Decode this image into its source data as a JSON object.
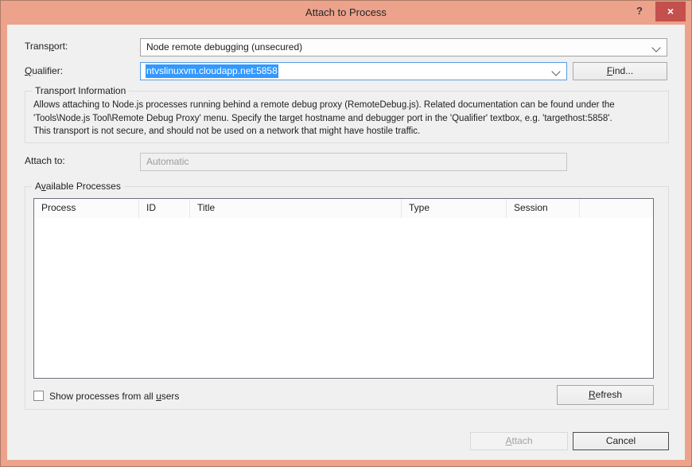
{
  "colors": {
    "chrome": "#eca28b",
    "chrome_edge": "#ab7a66",
    "close_red": "#c4504e",
    "selection": "#3399ff",
    "focus_border": "#569de5",
    "content_bg": "#f0f0f0"
  },
  "titlebar": {
    "title": "Attach to Process",
    "help_glyph": "?",
    "close_glyph": "×"
  },
  "transport": {
    "label_pre": "Trans",
    "label_key": "p",
    "label_post": "ort:",
    "value": "Node remote debugging (unsecured)"
  },
  "qualifier": {
    "label_pre": "",
    "label_key": "Q",
    "label_post": "ualifier:",
    "value": "ntvslinuxvm.cloudapp.net:5858",
    "find_pre": "",
    "find_key": "F",
    "find_post": "ind..."
  },
  "transport_info": {
    "title": "Transport Information",
    "line1": "Allows attaching to Node.js processes running behind a remote debug proxy (RemoteDebug.js). Related documentation can be found under the",
    "line2": "'Tools\\Node.js Tool\\Remote Debug Proxy' menu. Specify the target hostname and debugger port in the 'Qualifier' textbox, e.g. 'targethost:5858'.",
    "line3": "This transport is not secure, and should not be used on a network that might have hostile traffic."
  },
  "attach_to": {
    "label": "Attach to:",
    "value": "Automatic"
  },
  "processes": {
    "group_pre": "A",
    "group_key": "v",
    "group_post": "ailable Processes",
    "columns": [
      {
        "label": "Process"
      },
      {
        "label": "ID"
      },
      {
        "label": "Title"
      },
      {
        "label": "Type"
      },
      {
        "label": "Session"
      },
      {
        "label": ""
      }
    ],
    "rows": [],
    "show_all_pre": "Show processes from all ",
    "show_all_key": "u",
    "show_all_post": "sers",
    "show_all_checked": false,
    "refresh_pre": "",
    "refresh_key": "R",
    "refresh_post": "efresh"
  },
  "footer": {
    "attach_pre": "",
    "attach_key": "A",
    "attach_post": "ttach",
    "attach_enabled": false,
    "cancel_label": "Cancel"
  }
}
